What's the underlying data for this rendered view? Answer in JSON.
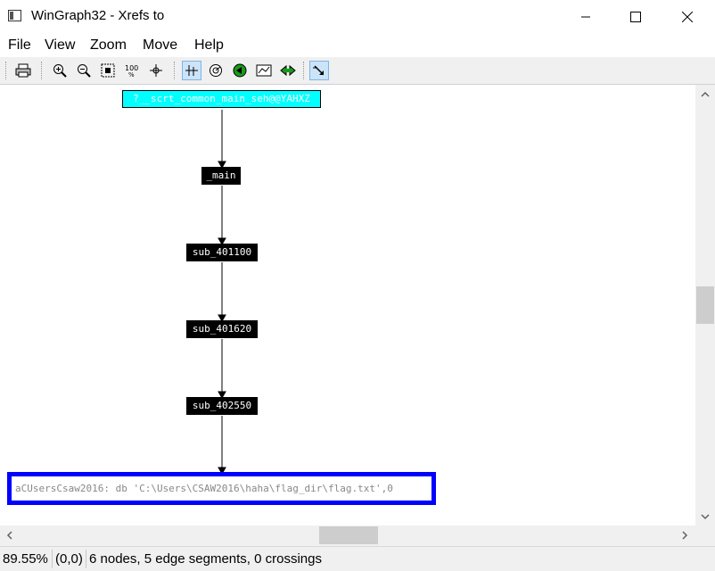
{
  "window": {
    "title": "WinGraph32 - Xrefs to"
  },
  "menu": {
    "items": [
      "File",
      "View",
      "Zoom",
      "Move",
      "Help"
    ]
  },
  "graph": {
    "root": "?__scrt_common_main_seh@@YAHXZ",
    "nodes": [
      "_main",
      "sub_401100",
      "sub_401620",
      "sub_402550"
    ],
    "data_node": "aCUsersCsaw2016: db 'C:\\Users\\CSAW2016\\haha\\flag_dir\\flag.txt',0"
  },
  "status": {
    "zoom": "89.55%",
    "coords": "(0,0)",
    "summary": "6 nodes, 5 edge segments, 0 crossings"
  }
}
